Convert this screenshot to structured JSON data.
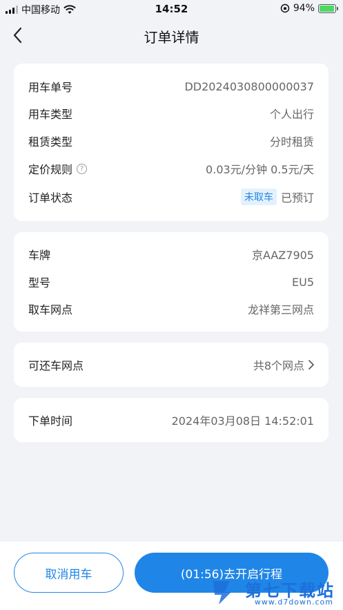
{
  "status_bar": {
    "carrier": "中国移动",
    "time": "14:52",
    "battery": "94%",
    "battery_level": 0.94
  },
  "nav": {
    "title": "订单详情"
  },
  "order_card": {
    "order_no_label": "用车单号",
    "order_no": "DD2024030800000037",
    "usage_type_label": "用车类型",
    "usage_type": "个人出行",
    "rental_type_label": "租赁类型",
    "rental_type": "分时租赁",
    "pricing_label": "定价规则",
    "pricing": "0.03元/分钟 0.5元/天",
    "status_label": "订单状态",
    "status_badge": "未取车",
    "status": "已预订"
  },
  "car_card": {
    "plate_label": "车牌",
    "plate": "京AAZ7905",
    "model_label": "型号",
    "model": "EU5",
    "pickup_label": "取车网点",
    "pickup": "龙祥第三网点"
  },
  "return_card": {
    "label": "可还车网点",
    "value": "共8个网点"
  },
  "time_card": {
    "label": "下单时间",
    "value": "2024年03月08日 14:52:01"
  },
  "actions": {
    "cancel_label": "取消用车",
    "start_label": "(01:56)去开启行程"
  },
  "watermark": {
    "text": "第七下载站",
    "url": "www.d7down.com"
  },
  "colors": {
    "accent": "#1f86e8",
    "background": "#f2f3f7",
    "badge_bg": "#e3f1fd"
  }
}
